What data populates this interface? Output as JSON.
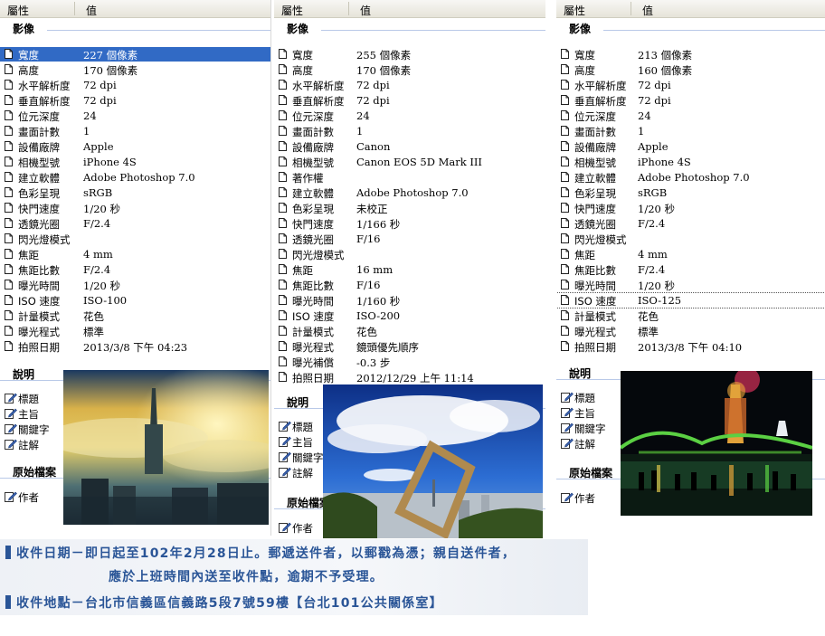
{
  "header": {
    "col1": "屬性",
    "col2": "值"
  },
  "panels": [
    {
      "section_image": "影像",
      "section_desc": "說明",
      "section_origin": "原始檔案",
      "rows": [
        {
          "name": "寬度",
          "value": "227 個像素",
          "selected": true
        },
        {
          "name": "高度",
          "value": "170 個像素"
        },
        {
          "name": "水平解析度",
          "value": "72 dpi"
        },
        {
          "name": "垂直解析度",
          "value": "72 dpi"
        },
        {
          "name": "位元深度",
          "value": "24"
        },
        {
          "name": "畫面計數",
          "value": "1"
        },
        {
          "name": "設備廠牌",
          "value": "Apple"
        },
        {
          "name": "相機型號",
          "value": "iPhone 4S"
        },
        {
          "name": "建立軟體",
          "value": "Adobe Photoshop 7.0"
        },
        {
          "name": "色彩呈現",
          "value": "sRGB"
        },
        {
          "name": "快門速度",
          "value": "1/20 秒"
        },
        {
          "name": "透鏡光圈",
          "value": "F/2.4"
        },
        {
          "name": "閃光燈模式",
          "value": ""
        },
        {
          "name": "焦距",
          "value": "4 mm"
        },
        {
          "name": "焦距比數",
          "value": "F/2.4"
        },
        {
          "name": "曝光時間",
          "value": "1/20 秒"
        },
        {
          "name": "ISO 速度",
          "value": "ISO-100"
        },
        {
          "name": "計量模式",
          "value": "花色"
        },
        {
          "name": "曝光程式",
          "value": "標準"
        },
        {
          "name": "拍照日期",
          "value": "2013/3/8 下午 04:23"
        }
      ],
      "desc_items": [
        "標題",
        "主旨",
        "關鍵字",
        "註解"
      ],
      "origin_items": [
        "作者"
      ]
    },
    {
      "section_image": "影像",
      "section_desc": "說明",
      "section_origin": "原始檔案",
      "rows": [
        {
          "name": "寬度",
          "value": "255 個像素"
        },
        {
          "name": "高度",
          "value": "170 個像素"
        },
        {
          "name": "水平解析度",
          "value": "72 dpi"
        },
        {
          "name": "垂直解析度",
          "value": "72 dpi"
        },
        {
          "name": "位元深度",
          "value": "24"
        },
        {
          "name": "畫面計數",
          "value": "1"
        },
        {
          "name": "設備廠牌",
          "value": "Canon"
        },
        {
          "name": "相機型號",
          "value": "Canon EOS 5D Mark III"
        },
        {
          "name": "著作權",
          "value": ""
        },
        {
          "name": "建立軟體",
          "value": "Adobe Photoshop 7.0"
        },
        {
          "name": "色彩呈現",
          "value": "未校正"
        },
        {
          "name": "快門速度",
          "value": "1/166 秒"
        },
        {
          "name": "透鏡光圈",
          "value": "F/16"
        },
        {
          "name": "閃光燈模式",
          "value": ""
        },
        {
          "name": "焦距",
          "value": "16 mm"
        },
        {
          "name": "焦距比數",
          "value": "F/16"
        },
        {
          "name": "曝光時間",
          "value": "1/160 秒"
        },
        {
          "name": "ISO 速度",
          "value": "ISO-200"
        },
        {
          "name": "計量模式",
          "value": "花色"
        },
        {
          "name": "曝光程式",
          "value": "鏡頭優先順序"
        },
        {
          "name": "曝光補償",
          "value": "-0.3 步"
        },
        {
          "name": "拍照日期",
          "value": "2012/12/29 上午 11:14"
        }
      ],
      "desc_items": [
        "標題",
        "主旨",
        "關鍵字",
        "註解"
      ],
      "origin_items": [
        "作者"
      ]
    },
    {
      "section_image": "影像",
      "section_desc": "說明",
      "section_origin": "原始檔案",
      "rows": [
        {
          "name": "寬度",
          "value": "213 個像素"
        },
        {
          "name": "高度",
          "value": "160 個像素"
        },
        {
          "name": "水平解析度",
          "value": "72 dpi"
        },
        {
          "name": "垂直解析度",
          "value": "72 dpi"
        },
        {
          "name": "位元深度",
          "value": "24"
        },
        {
          "name": "畫面計數",
          "value": "1"
        },
        {
          "name": "設備廠牌",
          "value": "Apple"
        },
        {
          "name": "相機型號",
          "value": "iPhone 4S"
        },
        {
          "name": "建立軟體",
          "value": "Adobe Photoshop 7.0"
        },
        {
          "name": "色彩呈現",
          "value": "sRGB"
        },
        {
          "name": "快門速度",
          "value": "1/20 秒"
        },
        {
          "name": "透鏡光圈",
          "value": "F/2.4"
        },
        {
          "name": "閃光燈模式",
          "value": ""
        },
        {
          "name": "焦距",
          "value": "4 mm"
        },
        {
          "name": "焦距比數",
          "value": "F/2.4"
        },
        {
          "name": "曝光時間",
          "value": "1/20 秒"
        },
        {
          "name": "ISO 速度",
          "value": "ISO-125",
          "focused": true
        },
        {
          "name": "計量模式",
          "value": "花色"
        },
        {
          "name": "曝光程式",
          "value": "標準"
        },
        {
          "name": "拍照日期",
          "value": "2013/3/8 下午 04:10"
        }
      ],
      "desc_items": [
        "標題",
        "主旨",
        "關鍵字",
        "註解"
      ],
      "origin_items": [
        "作者"
      ]
    }
  ],
  "banner": {
    "line1": "收件日期－即日起至102年2月28日止。郵遞送件者，以郵戳為憑；親自送件者，",
    "line1b": "應於上班時間內送至收件點，逾期不予受理。",
    "line2": "收件地點－台北市信義區信義路5段7號59樓【台北101公共關係室】"
  },
  "colors": {
    "selection": "#316ac5",
    "banner_text": "#2a5597",
    "section_line": "#b9c9e8"
  }
}
